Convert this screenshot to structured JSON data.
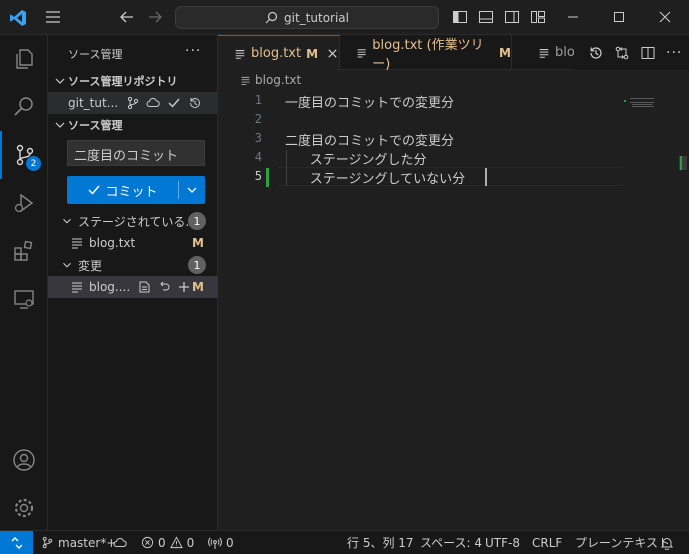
{
  "titlebar": {
    "search_text": "git_tutorial"
  },
  "activitybar": {
    "scm_badge": "2"
  },
  "sidebar": {
    "title": "ソース管理",
    "more": "···",
    "repos_header": "ソース管理リポジトリ",
    "repo_name": "git_tut...",
    "scm_header": "ソース管理",
    "commit_message": "二度目のコミット",
    "commit_button": "コミット",
    "staged_label": "ステージされている...",
    "staged_count": "1",
    "staged_file": "blog.txt",
    "staged_file_status": "M",
    "changes_label": "変更",
    "changes_count": "1",
    "changes_file": "blog....",
    "changes_file_status": "M"
  },
  "tabs": [
    {
      "label": "blog.txt",
      "status": "M",
      "active": true
    },
    {
      "label": "blog.txt (作業ツリー)",
      "status": "M",
      "active": false
    },
    {
      "label": "blo",
      "status": "",
      "active": false
    }
  ],
  "breadcrumb": {
    "file": "blog.txt"
  },
  "editor": {
    "lines": [
      {
        "num": "1",
        "text": "一度目のコミットでの変更分"
      },
      {
        "num": "2",
        "text": ""
      },
      {
        "num": "3",
        "text": "二度目のコミットでの変更分"
      },
      {
        "num": "4",
        "text": "      ステージングした分"
      },
      {
        "num": "5",
        "text": "      ステージングしていない分"
      }
    ],
    "current_line": "5"
  },
  "statusbar": {
    "branch": "master*+",
    "errors": "0",
    "warnings": "0",
    "ports": "0",
    "position": "行 5、列 17",
    "spaces": "スペース: 4",
    "encoding": "UTF-8",
    "eol": "CRLF",
    "language": "プレーンテキスト"
  },
  "colors": {
    "accent": "#0078d4",
    "modified": "#e2c08d",
    "added": "#2ea043"
  }
}
